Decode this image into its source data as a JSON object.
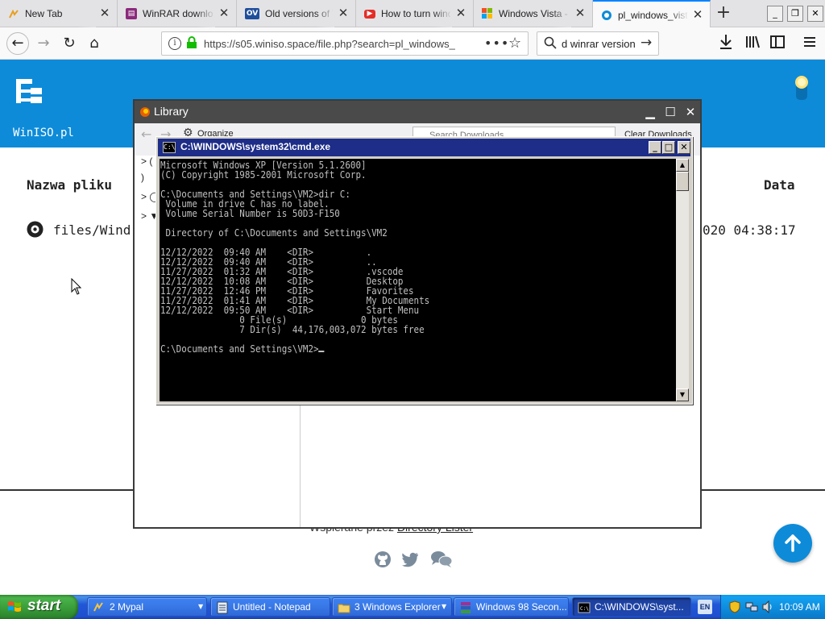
{
  "browser": {
    "tabs": [
      {
        "title": "New Tab",
        "active": false
      },
      {
        "title": "WinRAR download",
        "active": false
      },
      {
        "title": "Old versions of W",
        "active": false
      },
      {
        "title": "How to turn windo",
        "active": false
      },
      {
        "title": "Windows Vista - W",
        "active": false
      },
      {
        "title": "pl_windows_vista_",
        "active": true
      }
    ],
    "url": "https://s05.winiso.space/file.php?search=pl_windows_",
    "search_value": "d winrar version"
  },
  "page": {
    "site_name": "WinISO.pl",
    "col_name": "Nazwa pliku",
    "col_date": "Data",
    "file_name": "files/Wind",
    "file_date": "020 04:38:17",
    "powered_prefix": "Wspierane przez",
    "powered_link": "Directory Lister"
  },
  "library": {
    "title": "Library",
    "search_placeholder": "Search Downloads",
    "clear_label": "Clear Downloads",
    "organize_label": "Organize",
    "tree": [
      ">",
      "",
      ">",
      ">"
    ]
  },
  "cmd": {
    "title": "C:\\WINDOWS\\system32\\cmd.exe",
    "lines": [
      "Microsoft Windows XP [Version 5.1.2600]",
      "(C) Copyright 1985-2001 Microsoft Corp.",
      "",
      "C:\\Documents and Settings\\VM2>dir C:",
      " Volume in drive C has no label.",
      " Volume Serial Number is 50D3-F150",
      "",
      " Directory of C:\\Documents and Settings\\VM2",
      "",
      "12/12/2022  09:40 AM    <DIR>          .",
      "12/12/2022  09:40 AM    <DIR>          ..",
      "11/27/2022  01:32 AM    <DIR>          .vscode",
      "12/12/2022  10:08 AM    <DIR>          Desktop",
      "11/27/2022  12:46 PM    <DIR>          Favorites",
      "11/27/2022  01:41 AM    <DIR>          My Documents",
      "12/12/2022  09:50 AM    <DIR>          Start Menu",
      "               0 File(s)              0 bytes",
      "               7 Dir(s)  44,176,003,072 bytes free",
      "",
      "C:\\Documents and Settings\\VM2>"
    ]
  },
  "taskbar": {
    "start_label": "start",
    "buttons": [
      {
        "label": "2 Mypal",
        "active": false
      },
      {
        "label": "Untitled - Notepad",
        "active": false
      },
      {
        "label": "3 Windows Explorer",
        "active": false
      },
      {
        "label": "Windows 98 Secon...",
        "active": false
      },
      {
        "label": "C:\\WINDOWS\\syst...",
        "active": true
      }
    ],
    "lang": "EN",
    "clock": "10:09 AM"
  },
  "colors": {
    "site_blue": "#0d8bd9",
    "xp_taskbar": "#245edb",
    "xp_start_green": "#3c9a3c",
    "console_bg": "#000000",
    "console_fg": "#c0c0c0"
  },
  "icons": [
    "firefox-tab-icon",
    "winrar-icon",
    "oldversion-icon",
    "youtube-icon",
    "windows-icon",
    "winiso-icon",
    "back-icon",
    "forward-icon",
    "reload-icon",
    "home-icon",
    "info-icon",
    "lock-icon",
    "more-icon",
    "star-icon",
    "search-icon",
    "go-arrow-icon",
    "download-icon",
    "library-icon",
    "sidebar-icon",
    "menu-icon",
    "github-icon",
    "twitter-icon",
    "chat-icon",
    "arrow-up-icon",
    "lightbulb-icon",
    "disc-icon"
  ]
}
